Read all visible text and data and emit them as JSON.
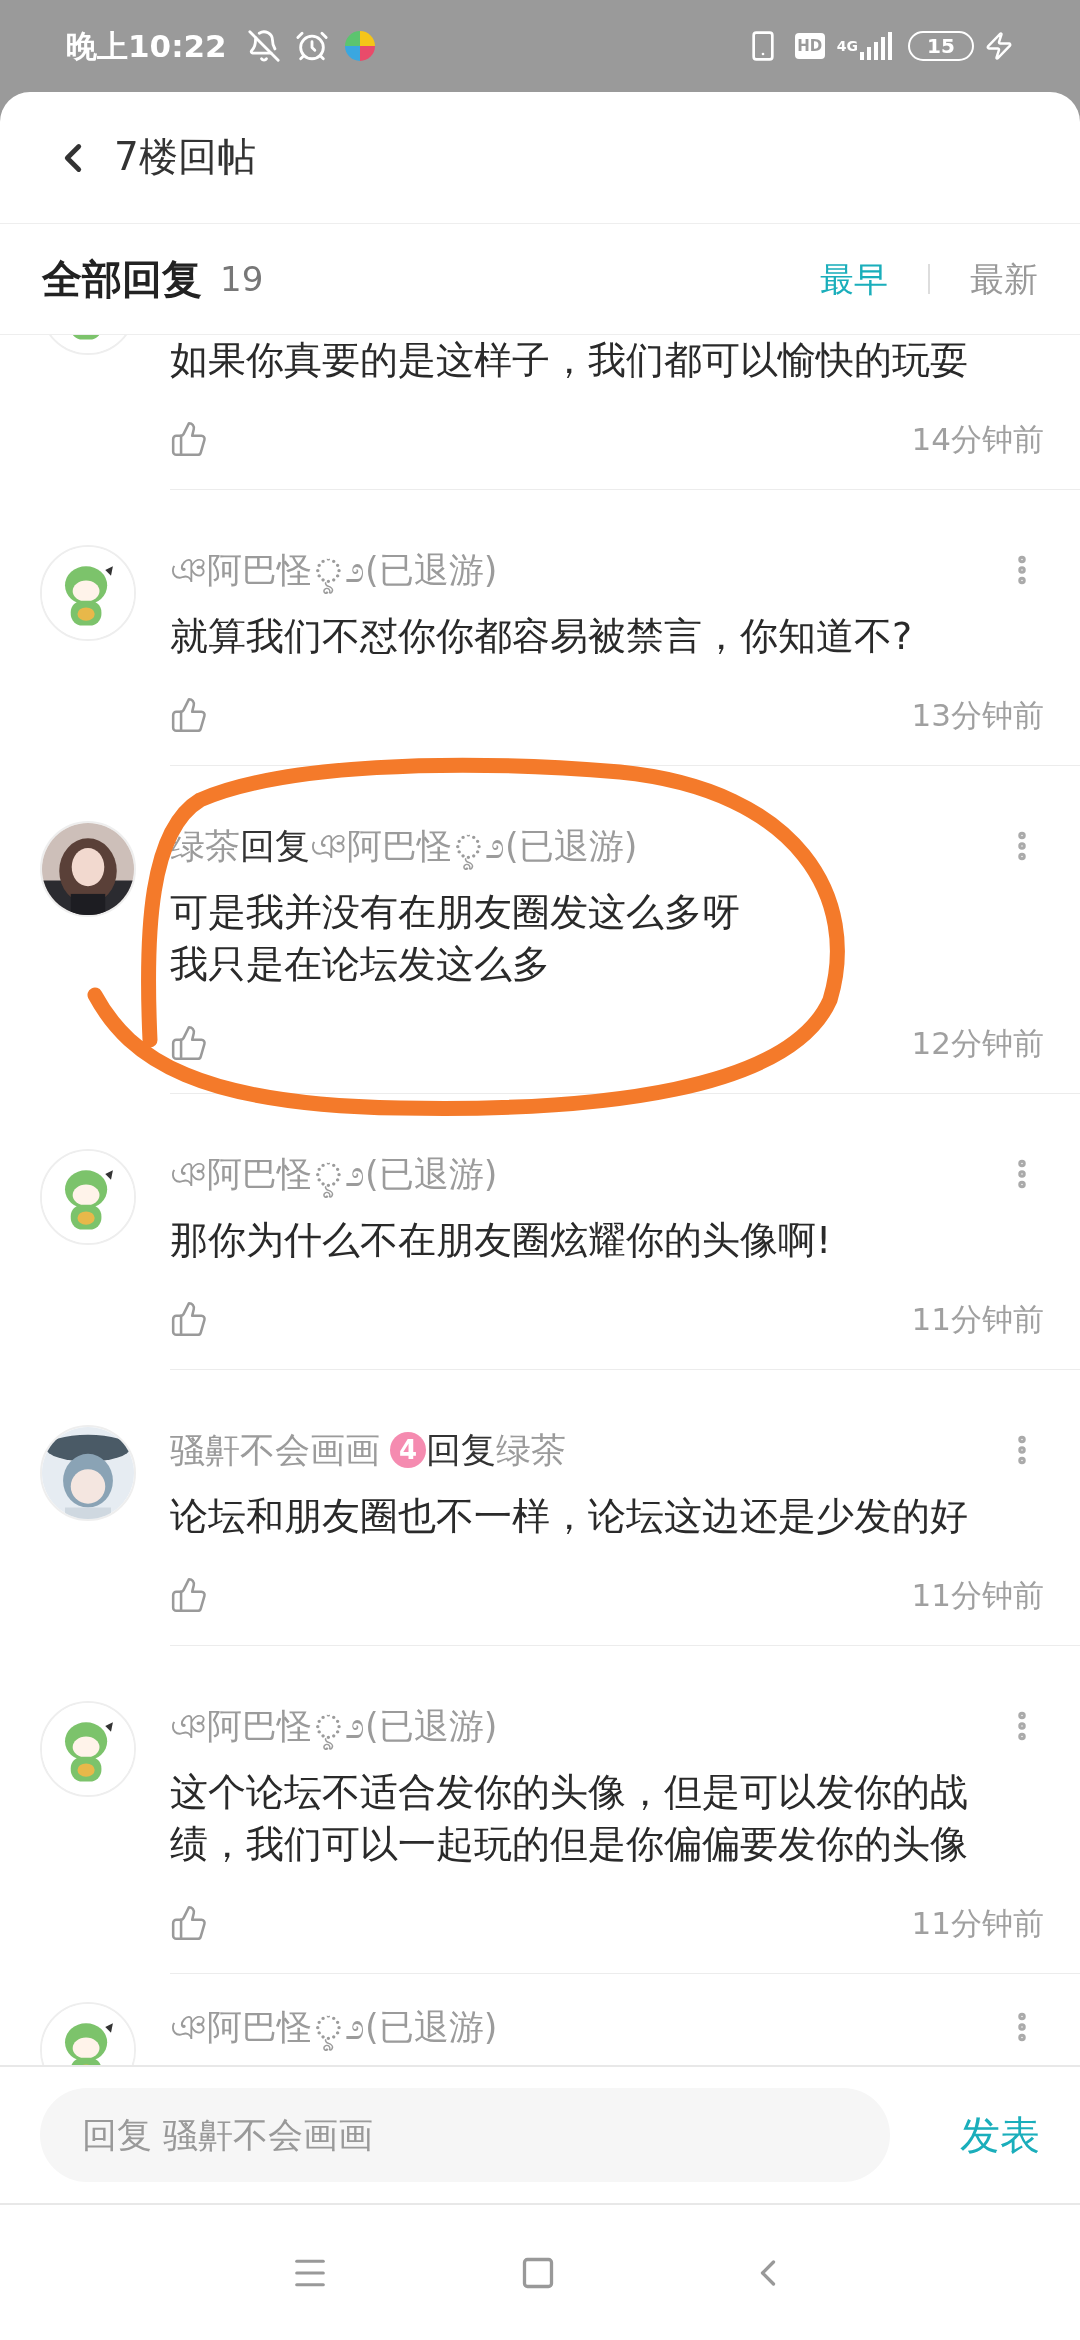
{
  "status_bar": {
    "time": "晚上10:22",
    "hd": "HD",
    "network": "4G",
    "battery": "15"
  },
  "header": {
    "title": "7楼回帖"
  },
  "replies_header": {
    "title": "全部回复",
    "count": "19",
    "sort": [
      {
        "label": "最早",
        "selected": true
      },
      {
        "label": "最新",
        "selected": false
      }
    ]
  },
  "comments": [
    {
      "avatar": {
        "kind": "sticker"
      },
      "lines": [
        "如果你真要的是这样子，我们都可以愉快的玩耍"
      ],
      "time": "14分钟前"
    },
    {
      "avatar": {
        "kind": "sticker"
      },
      "author": "ঞ阿巴怪ৢ೨(已退游)",
      "lines": [
        "就算我们不怼你你都容易被禁言，你知道不?"
      ],
      "time": "13分钟前"
    },
    {
      "author": "绿茶",
      "reply_word": "回复",
      "reply_to": "ঞ阿巴怪ৢ೨(已退游)",
      "lines": [
        "可是我并没有在朋友圈发这么多呀",
        "我只是在论坛发这么多"
      ],
      "time": "12分钟前"
    },
    {
      "avatar": {
        "kind": "sticker"
      },
      "author": "ঞ阿巴怪ৢ೨(已退游)",
      "lines": [
        "那你为什么不在朋友圈炫耀你的头像啊!"
      ],
      "time": "11分钟前"
    },
    {
      "avatar": {
        "kind": "drawing"
      },
      "author": "骚鼾不会画画",
      "badge": "4",
      "reply_word": "回复",
      "reply_to": "绿茶",
      "lines": [
        "论坛和朋友圈也不一样，论坛这边还是少发的好"
      ],
      "time": "11分钟前"
    },
    {
      "avatar": {
        "kind": "sticker"
      },
      "author": "ঞ阿巴怪ৢ೨(已退游)",
      "lines": [
        "这个论坛不适合发你的头像，但是可以发你的战绩，我们可以一起玩的但是你偏偏要发你的头像"
      ],
      "time": "11分钟前"
    },
    {
      "avatar": {
        "kind": "sticker"
      },
      "author": "ঞ阿巴怪ৢ೨(已退游)"
    }
  ],
  "reply_bar": {
    "placeholder": "回复 骚鼾不会画画",
    "send": "发表"
  },
  "annotation": {
    "kind": "circle"
  }
}
